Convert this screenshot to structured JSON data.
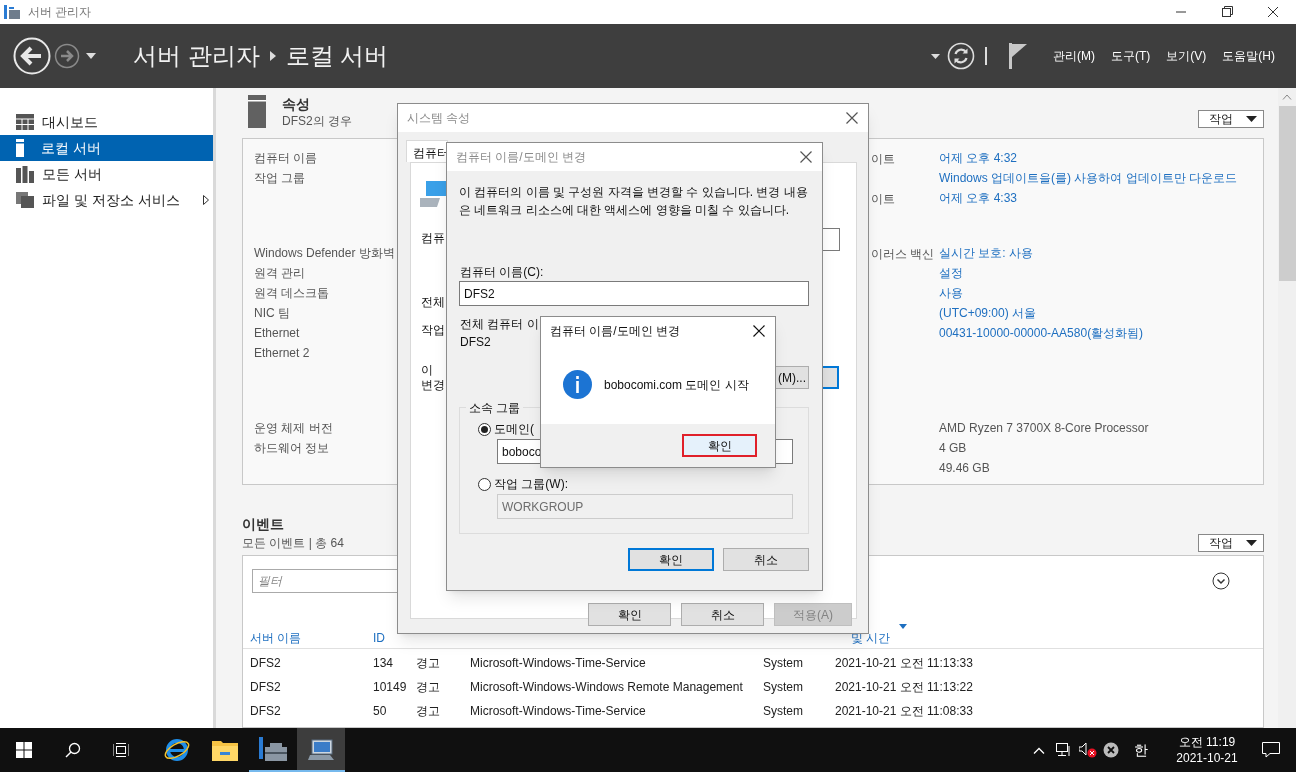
{
  "window": {
    "title": "서버 관리자"
  },
  "header": {
    "breadcrumb": [
      "서버 관리자",
      "로컬 서버"
    ],
    "menus": [
      "관리(M)",
      "도구(T)",
      "보기(V)",
      "도움말(H)"
    ]
  },
  "sidebar": {
    "items": [
      {
        "kind": "dashboard",
        "label": "대시보드",
        "selected": false,
        "expandable": false
      },
      {
        "kind": "local",
        "label": "로컬 서버",
        "selected": true,
        "expandable": false
      },
      {
        "kind": "all",
        "label": "모든 서버",
        "selected": false,
        "expandable": false
      },
      {
        "kind": "files",
        "label": "파일 및 저장소 서비스",
        "selected": false,
        "expandable": true
      }
    ]
  },
  "properties": {
    "title": "속성",
    "subtitle": "DFS2의 경우",
    "task_button": "작업",
    "groups": [
      {
        "left": [
          "컴퓨터 이름",
          "작업 그룹"
        ],
        "right": [
          {
            "label": "이트",
            "value": "어제 오후 4:32"
          },
          {
            "value": "Windows 업데이트을(를) 사용하여 업데이트만 다운로드"
          },
          {
            "label": "이트",
            "value": "어제 오후 4:33"
          }
        ]
      },
      {
        "left": [
          "Windows Defender 방화벽",
          "원격 관리",
          "원격 데스크톱",
          "NIC 팀",
          "Ethernet",
          "Ethernet 2"
        ],
        "right": [
          {
            "label": "이러스 백신",
            "value": "실시간 보호: 사용"
          },
          {
            "value": "설정"
          },
          {
            "value": "사용"
          },
          {
            "value": "(UTC+09:00) 서울"
          },
          {
            "value": "00431-10000-00000-AA580(활성화됨)"
          }
        ]
      },
      {
        "left": [
          "운영 체제 버전",
          "하드웨어 정보"
        ],
        "right": [
          {
            "value": "AMD Ryzen 7 3700X 8-Core Processor",
            "plain": true
          },
          {
            "value": "4 GB",
            "plain": true
          },
          {
            "value": "49.46 GB",
            "plain": true
          }
        ]
      }
    ]
  },
  "events": {
    "title": "이벤트",
    "subtitle": "모든 이벤트 | 총 64",
    "task_button": "작업",
    "filter": {
      "placeholder": "필터"
    },
    "columns": [
      "서버 이름",
      "ID",
      "",
      "",
      "",
      "및 시간"
    ],
    "rows": [
      [
        "DFS2",
        "134",
        "경고",
        "Microsoft-Windows-Time-Service",
        "System",
        "2021-10-21 오전 11:13:33"
      ],
      [
        "DFS2",
        "10149",
        "경고",
        "Microsoft-Windows-Windows Remote Management",
        "System",
        "2021-10-21 오전 11:13:22"
      ],
      [
        "DFS2",
        "50",
        "경고",
        "Microsoft-Windows-Time-Service",
        "System",
        "2021-10-21 오전 11:08:33"
      ]
    ]
  },
  "system_properties": {
    "title": "시스템 속성",
    "active": false,
    "tab": "컴퓨터",
    "fragments": [
      "컴퓨",
      "전체",
      "작업",
      "이",
      "변경"
    ],
    "buttons": [
      {
        "label": "확인",
        "disabled": false
      },
      {
        "label": "취소",
        "disabled": false
      },
      {
        "label": "적용(A)",
        "disabled": true
      }
    ]
  },
  "name_change": {
    "title": "컴퓨터 이름/도메인 변경",
    "active": false,
    "description": "이 컴퓨터의 이름 및 구성원 자격을 변경할 수 있습니다. 변경 내용은 네트워크 리소스에 대한 액세스에 영향을 미칠 수 있습니다.",
    "name_label": "컴퓨터 이름(C):",
    "name_value": "DFS2",
    "full_name_label": "전체 컴퓨터 이",
    "full_name": "DFS2",
    "more_button": "(M)...",
    "group_title": "소속 그룹",
    "options": [
      {
        "label": "도메인(",
        "selected": true,
        "value": "boboco",
        "disabled": false
      },
      {
        "label": "작업 그룹(W):",
        "selected": false,
        "value": "WORKGROUP",
        "disabled": true
      }
    ],
    "buttons": [
      {
        "label": "확인",
        "default": true
      },
      {
        "label": "취소",
        "default": false
      }
    ]
  },
  "message_box": {
    "title": "컴퓨터 이름/도메인 변경",
    "active": true,
    "message": "bobocomi.com 도메인 시작",
    "button": "확인",
    "highlighted": true
  },
  "taskbar": {
    "apps": [
      {
        "kind": "browser",
        "running": false,
        "selected": false
      },
      {
        "kind": "folder",
        "running": false,
        "selected": false
      },
      {
        "kind": "server-manager",
        "running": true,
        "selected": false
      },
      {
        "kind": "system",
        "running": true,
        "selected": true
      }
    ],
    "ime": "한",
    "time": "오전 11:19",
    "date": "2021-10-21"
  }
}
